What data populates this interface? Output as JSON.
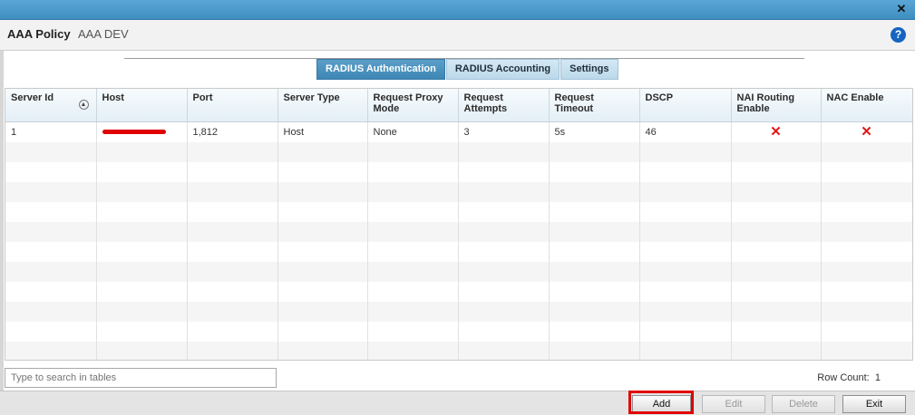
{
  "header": {
    "title": "AAA Policy",
    "policy_name": "AAA DEV"
  },
  "tabs": [
    {
      "label": "RADIUS Authentication",
      "active": true
    },
    {
      "label": "RADIUS Accounting",
      "active": false
    },
    {
      "label": "Settings",
      "active": false
    }
  ],
  "table": {
    "columns": [
      "Server Id",
      "Host",
      "Port",
      "Server Type",
      "Request Proxy Mode",
      "Request Attempts",
      "Request Timeout",
      "DSCP",
      "NAI Routing Enable",
      "NAC Enable"
    ],
    "rows": [
      {
        "server_id": "1",
        "host": "",
        "port": "1,812",
        "server_type": "Host",
        "proxy_mode": "None",
        "attempts": "3",
        "timeout": "5s",
        "dscp": "46",
        "nai_routing": "✕",
        "nac_enable": "✕"
      }
    ]
  },
  "search": {
    "placeholder": "Type to search in tables"
  },
  "row_count": {
    "label": "Row Count:",
    "value": "1"
  },
  "buttons": {
    "add": "Add",
    "edit": "Edit",
    "delete": "Delete",
    "exit": "Exit"
  },
  "icons": {
    "close": "close-icon",
    "help": "help-icon",
    "sort": "sort-ascending-icon",
    "false": "red-x-icon"
  },
  "colors": {
    "accent": "#3f86b5",
    "danger": "#e00000"
  }
}
